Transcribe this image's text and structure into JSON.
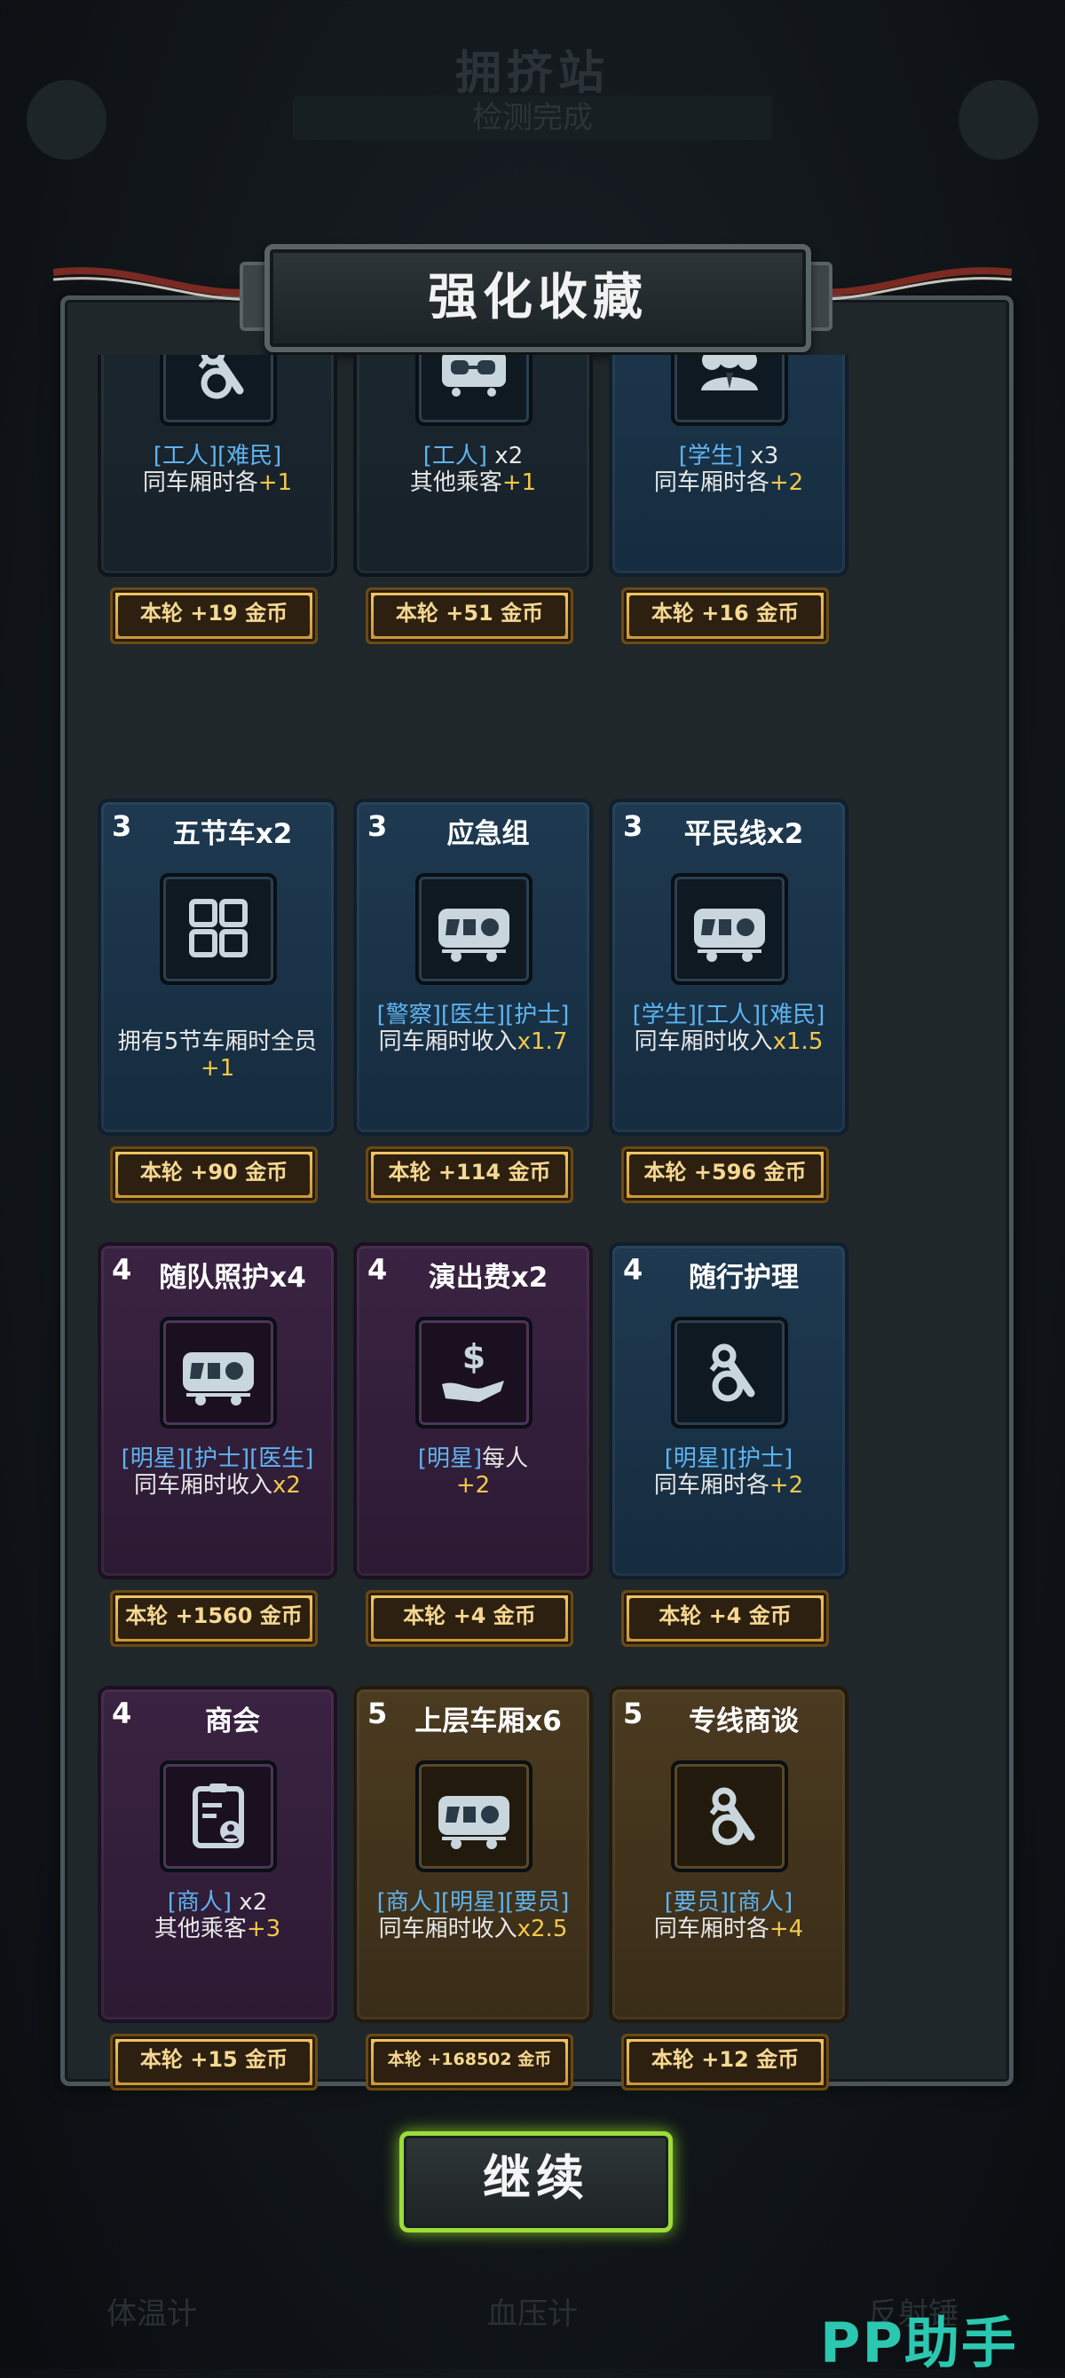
{
  "background": {
    "title": "拥挤站",
    "subtitle": "检测完成",
    "bottom_tabs": [
      "体温计",
      "血压计",
      "反射锤"
    ]
  },
  "panel": {
    "title": "强化收藏"
  },
  "cards": [
    {
      "level": "",
      "name": "",
      "icon": "pin-tool-icon",
      "color": "dark",
      "tags": "[工人][难民]",
      "text": "同车厢时各",
      "num": "+1",
      "reward": "本轮 +19 金币"
    },
    {
      "level": "",
      "name": "",
      "icon": "linked-car-icon",
      "color": "dark",
      "tags": "[工人]",
      "text_inline": " x2",
      "text": "其他乘客",
      "num": "+1",
      "reward": "本轮 +51 金币"
    },
    {
      "level": "",
      "name": "",
      "icon": "people-icon",
      "color": "blue",
      "tags": "[学生]",
      "text_inline": " x3",
      "text": "同车厢时各",
      "num": "+2",
      "reward": "本轮 +16 金币"
    },
    {
      "level": "3",
      "name": "五节车x2",
      "icon": "grid-icon",
      "color": "blue",
      "tags": "",
      "text": "拥有5节车厢时全员",
      "num": "+1",
      "reward": "本轮 +90 金币"
    },
    {
      "level": "3",
      "name": "应急组",
      "icon": "train-car-icon",
      "color": "blue",
      "tags": "[警察][医生][护士]",
      "text": "同车厢时收入",
      "num": "x1.7",
      "reward": "本轮 +114 金币"
    },
    {
      "level": "3",
      "name": "平民线x2",
      "icon": "train-car-icon",
      "color": "blue",
      "tags": "[学生][工人][难民]",
      "text": "同车厢时收入",
      "num": "x1.5",
      "reward": "本轮 +596 金币"
    },
    {
      "level": "4",
      "name": "随队照护x4",
      "icon": "train-car-icon",
      "color": "purple",
      "tags": "[明星][护士][医生]",
      "text": "同车厢时收入",
      "num": "x2",
      "reward": "本轮 +1560 金币"
    },
    {
      "level": "4",
      "name": "演出费x2",
      "icon": "money-hand-icon",
      "color": "purple",
      "tags": "[明星]",
      "text_inline": "每人",
      "text": "",
      "num": "+2",
      "reward": "本轮 +4 金币"
    },
    {
      "level": "4",
      "name": "随行护理",
      "icon": "pin-tool-icon",
      "color": "blue",
      "tags": "[明星][护士]",
      "text": "同车厢时各",
      "num": "+2",
      "reward": "本轮 +4 金币"
    },
    {
      "level": "4",
      "name": "商会",
      "icon": "badge-icon",
      "color": "purple",
      "tags": "[商人]",
      "text_inline": " x2",
      "text": "其他乘客",
      "num": "+3",
      "reward": "本轮 +15 金币"
    },
    {
      "level": "5",
      "name": "上层车厢x6",
      "icon": "train-car-icon",
      "color": "gold",
      "tags": "[商人][明星][要员]",
      "text": "同车厢时收入",
      "num": "x2.5",
      "reward": "本轮 +168502 金币"
    },
    {
      "level": "5",
      "name": "专线商谈",
      "icon": "pin-tool-icon",
      "color": "gold",
      "tags": "[要员][商人]",
      "text": "同车厢时各",
      "num": "+4",
      "reward": "本轮 +12 金币"
    }
  ],
  "continue_button": {
    "label": "继续"
  },
  "watermark": "PP助手"
}
